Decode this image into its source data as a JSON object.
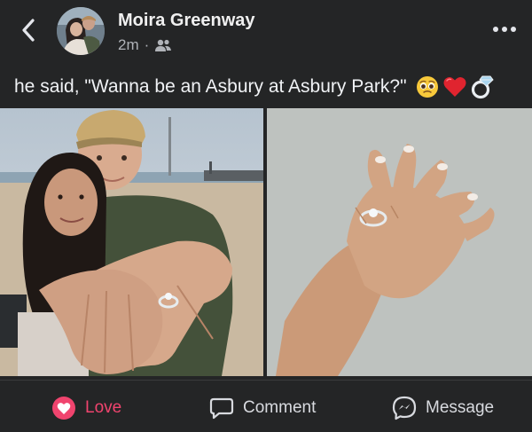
{
  "post": {
    "author": "Moira Greenway",
    "time": "2m",
    "separator": "·",
    "audience_icon": "friends-icon",
    "caption": "he said, \"Wanna be an Asbury at Asbury Park?\"",
    "caption_emojis": [
      "pleading-face-icon",
      "red-heart-icon",
      "ring-icon"
    ]
  },
  "photos": [
    {
      "name": "couple-proposal-photo",
      "alt": ""
    },
    {
      "name": "ring-hand-photo",
      "alt": ""
    }
  ],
  "actions": {
    "love_label": "Love",
    "comment_label": "Comment",
    "message_label": "Message"
  },
  "colors": {
    "background": "#242526",
    "love_accent": "#f0446e",
    "secondary_text": "#b0b3b8"
  }
}
